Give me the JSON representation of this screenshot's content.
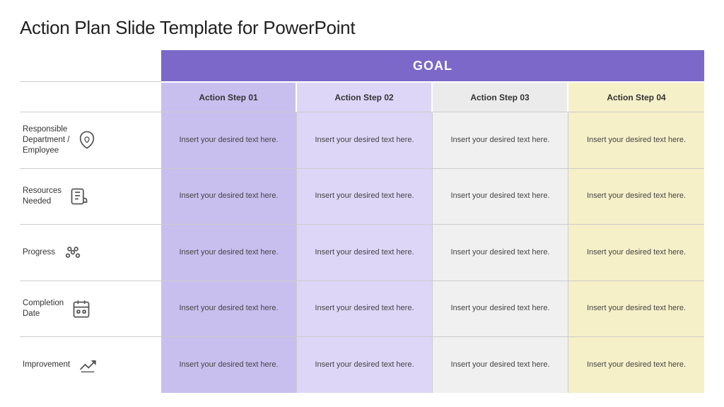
{
  "slide": {
    "title": "Action Plan Slide Template for PowerPoint",
    "goal_label": "GOAL",
    "col_headers": [
      "Action Step 01",
      "Action Step 02",
      "Action Step 03",
      "Action Step 04"
    ],
    "rows": [
      {
        "label": "Responsible Department / Employee",
        "icon": "shield-heart",
        "cells": [
          "Insert your desired text here.",
          "Insert your desired text here.",
          "Insert your desired text here.",
          "Insert your desired text here."
        ]
      },
      {
        "label": "Resources Needed",
        "icon": "resources",
        "cells": [
          "Insert your desired text here.",
          "Insert your desired text here.",
          "Insert your desired text here.",
          "Insert your desired text here."
        ]
      },
      {
        "label": "Progress",
        "icon": "progress",
        "cells": [
          "Insert your desired text here.",
          "Insert your desired text here.",
          "Insert your desired text here.",
          "Insert your desired text here."
        ]
      },
      {
        "label": "Completion Date",
        "icon": "calendar",
        "cells": [
          "Insert your desired text here.",
          "Insert your desired text here.",
          "Insert your desired text here.",
          "Insert your desired text here."
        ]
      },
      {
        "label": "Improvement",
        "icon": "improvement",
        "cells": [
          "Insert your desired text here.",
          "Insert your desired text here.",
          "Insert your desired text here.",
          "Insert your desired text here."
        ]
      }
    ]
  }
}
